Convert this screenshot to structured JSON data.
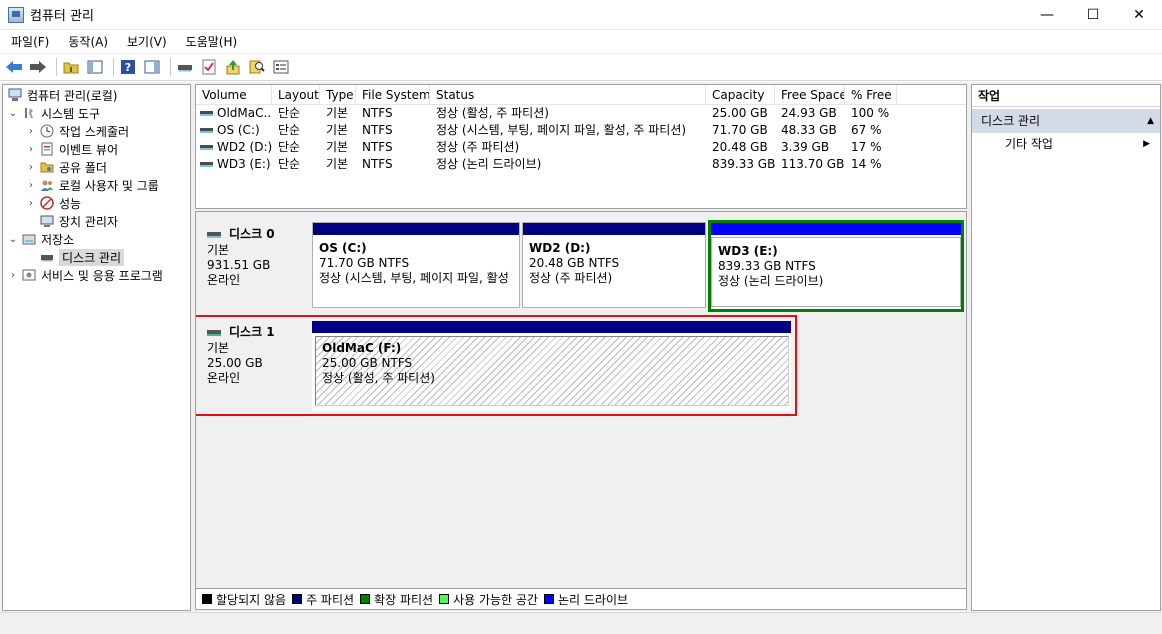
{
  "window": {
    "title": "컴퓨터 관리",
    "minimize": "—",
    "maximize": "☐",
    "close": "✕"
  },
  "menu": [
    "파일(F)",
    "동작(A)",
    "보기(V)",
    "도움말(H)"
  ],
  "tree": {
    "root": "컴퓨터 관리(로컬)",
    "system_tools": "시스템 도구",
    "task_scheduler": "작업 스케줄러",
    "event_viewer": "이벤트 뷰어",
    "shared_folders": "공유 폴더",
    "local_users": "로컬 사용자 및 그룹",
    "performance": "성능",
    "device_manager": "장치 관리자",
    "storage": "저장소",
    "disk_management": "디스크 관리",
    "services": "서비스 및 응용 프로그램"
  },
  "volume_list": {
    "headers": [
      "Volume",
      "Layout",
      "Type",
      "File System",
      "Status",
      "Capacity",
      "Free Space",
      "% Free"
    ],
    "rows": [
      [
        "OldMaC...",
        "단순",
        "기본",
        "NTFS",
        "정상 (활성, 주 파티션)",
        "25.00 GB",
        "24.93 GB",
        "100 %"
      ],
      [
        "OS (C:)",
        "단순",
        "기본",
        "NTFS",
        "정상 (시스템, 부팅, 페이지 파일, 활성, 주 파티션)",
        "71.70 GB",
        "48.33 GB",
        "67 %"
      ],
      [
        "WD2 (D:)",
        "단순",
        "기본",
        "NTFS",
        "정상 (주 파티션)",
        "20.48 GB",
        "3.39 GB",
        "17 %"
      ],
      [
        "WD3 (E:)",
        "단순",
        "기본",
        "NTFS",
        "정상 (논리 드라이브)",
        "839.33 GB",
        "113.70 GB",
        "14 %"
      ]
    ]
  },
  "disks": {
    "disk0": {
      "name": "디스크 0",
      "type": "기본",
      "size": "931.51 GB",
      "state": "온라인",
      "parts": [
        {
          "name": "OS  (C:)",
          "size": "71.70 GB NTFS",
          "status": "정상 (시스템, 부팅, 페이지 파일, 활성"
        },
        {
          "name": "WD2  (D:)",
          "size": "20.48 GB NTFS",
          "status": "정상 (주 파티션)"
        },
        {
          "name": "WD3  (E:)",
          "size": "839.33 GB NTFS",
          "status": "정상 (논리 드라이브)"
        }
      ]
    },
    "disk1": {
      "name": "디스크 1",
      "type": "기본",
      "size": "25.00 GB",
      "state": "온라인",
      "parts": [
        {
          "name": "OldMaC  (F:)",
          "size": "25.00 GB NTFS",
          "status": "정상 (활성, 주 파티션)"
        }
      ]
    }
  },
  "legend": [
    {
      "label": "할당되지 않음",
      "color": "#000000"
    },
    {
      "label": "주 파티션",
      "color": "#000080"
    },
    {
      "label": "확장 파티션",
      "color": "#008000"
    },
    {
      "label": "사용 가능한 공간",
      "color": "#4cff4c"
    },
    {
      "label": "논리 드라이브",
      "color": "#0000ff"
    }
  ],
  "actions": {
    "header": "작업",
    "section": "디스크 관리",
    "more": "기타 작업"
  },
  "colors": {
    "selected_red": "#e01010",
    "selected_green": "#008000",
    "primary": "#000080",
    "logical": "#0000ff"
  }
}
